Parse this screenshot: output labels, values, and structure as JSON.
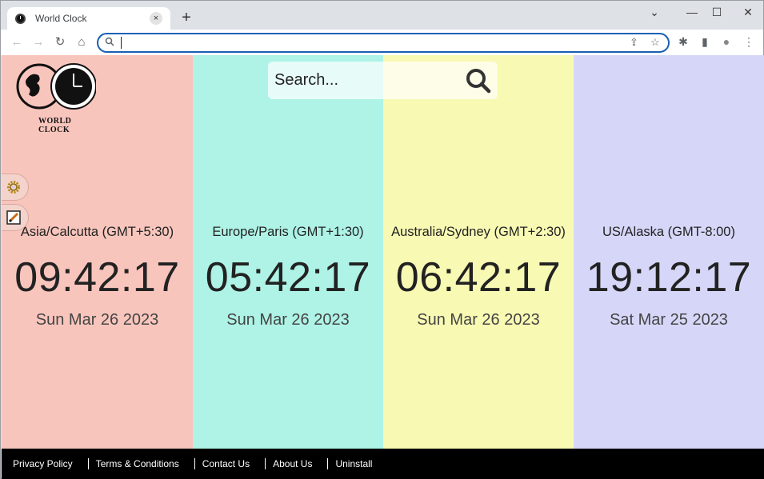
{
  "browser": {
    "tab_title": "World Clock",
    "tab_close": "×",
    "new_tab": "+",
    "omnibox_value": "",
    "icons": {
      "back": "←",
      "forward": "→",
      "reload": "↻",
      "home": "⌂",
      "omnibox_search": "⚲",
      "share": "⇪",
      "bookmark": "☆",
      "extensions": "✱",
      "sidepanel": "▮",
      "profile": "●",
      "menu": "⋮",
      "tab_list": "⌄",
      "minimize": "—",
      "maximize": "☐",
      "close": "✕"
    }
  },
  "app": {
    "logo_text": "WORLD CLOCK",
    "search_placeholder": "Search...",
    "clocks": [
      {
        "zone": "Asia/Calcutta (GMT+5:30)",
        "time": "09:42:17",
        "date": "Sun Mar 26 2023",
        "color": "#f8c5bc"
      },
      {
        "zone": "Europe/Paris (GMT+1:30)",
        "time": "05:42:17",
        "date": "Sun Mar 26 2023",
        "color": "#aef3e6"
      },
      {
        "zone": "Australia/Sydney (GMT+2:30)",
        "time": "06:42:17",
        "date": "Sun Mar 26 2023",
        "color": "#f8f9b3"
      },
      {
        "zone": "US/Alaska (GMT-8:00)",
        "time": "19:12:17",
        "date": "Sat Mar 25 2023",
        "color": "#d6d7f8"
      }
    ],
    "footer_links": [
      "Privacy Policy",
      "Terms & Conditions",
      "Contact Us",
      "About Us",
      "Uninstall"
    ]
  }
}
